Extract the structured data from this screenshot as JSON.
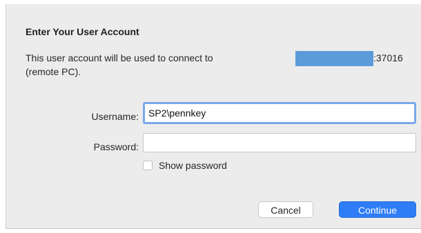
{
  "dialog": {
    "title": "Enter Your User Account",
    "description_line1": "This user account will be used to connect to",
    "description_port": ":37016",
    "description_line2": "(remote PC).",
    "redaction_color": "#5b9bd9"
  },
  "form": {
    "username_label": "Username:",
    "username_value": "SP2\\pennkey",
    "password_label": "Password:",
    "password_value": "",
    "show_password_label": "Show password",
    "show_password_checked": false
  },
  "buttons": {
    "cancel_label": "Cancel",
    "continue_label": "Continue"
  },
  "colors": {
    "accent": "#2e7cf6",
    "focus_ring": "#7aa7e9"
  }
}
